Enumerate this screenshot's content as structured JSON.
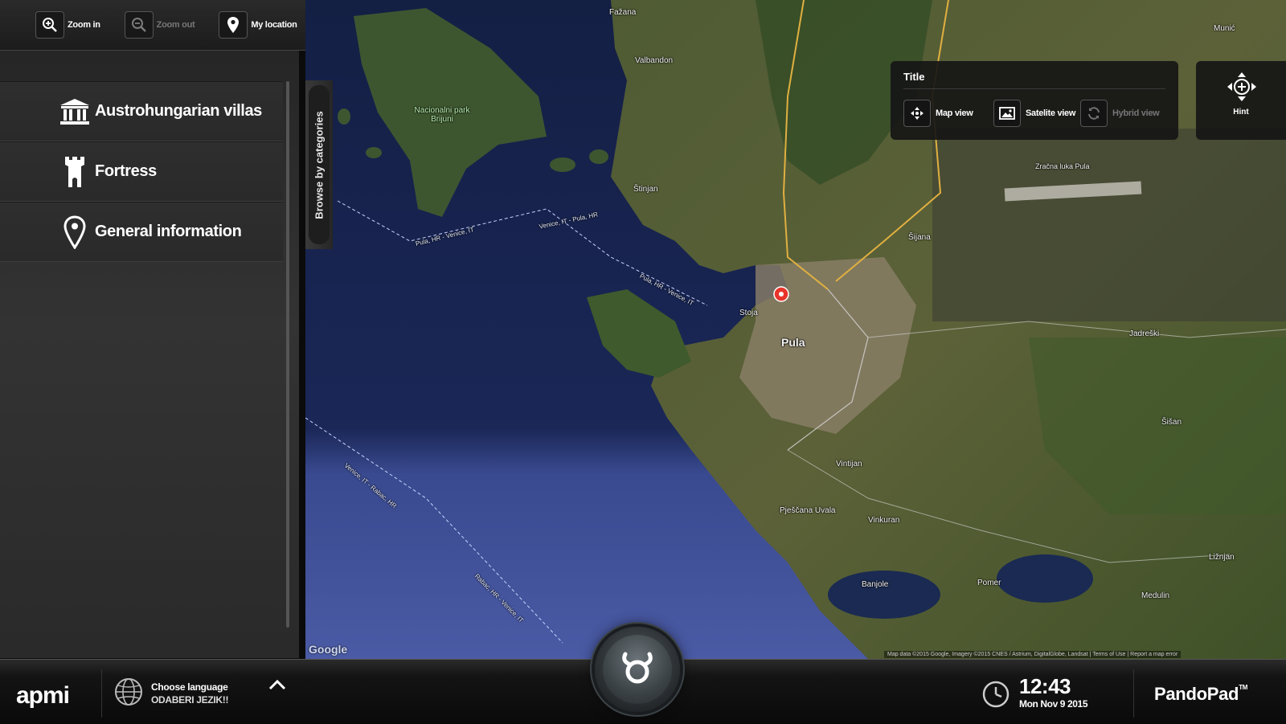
{
  "toolbar": {
    "zoom_in": "Zoom in",
    "zoom_out": "Zoom out",
    "my_location": "My location"
  },
  "sidebar": {
    "browse_label": "Browse by categories",
    "items": [
      {
        "label": "Austrohungarian villas",
        "icon": "museum-icon"
      },
      {
        "label": "Fortress",
        "icon": "tower-icon"
      },
      {
        "label": "General information",
        "icon": "location-pin-icon"
      }
    ]
  },
  "map_type": {
    "title": "Title",
    "map_view": "Map view",
    "satellite_view": "Satelite view",
    "hybrid_view": "Hybrid view"
  },
  "hint": {
    "label": "Hint"
  },
  "map": {
    "labels": {
      "pula": "Pula",
      "stinjan": "Štinjan",
      "fazana": "Fažana",
      "valbandon": "Valbandon",
      "veliki_brijun": "Nacionalni park Brijuni",
      "sijana": "Šijana",
      "vintijan": "Vintijan",
      "pjescana_uvala": "Pješčana Uvala",
      "vinkuran": "Vinkuran",
      "banjole": "Banjole",
      "premantura": "Pomer",
      "medulin": "Medulin",
      "liznjan": "Ližnjan",
      "sisan": "Šišan",
      "jadreski": "Jadreški",
      "airport": "Zračna luka Pula",
      "munic": "Munić",
      "stoja": "Stoja",
      "route1": "Pula, HR - Venice, IT",
      "route2": "Venice, IT - Pula, HR",
      "route3": "Pula, HR - Venice, IT",
      "route4": "Venice, IT - Rabac, HR",
      "route5": "Rabac, HR - Venice, IT"
    },
    "google": "Google",
    "attribution": "Map data ©2015 Google, Imagery ©2015 CNES / Astrium, DigitalGlobe, Landsat | Terms of Use | Report a map error"
  },
  "bottom": {
    "logo": "apmi",
    "lang_line1": "Choose language",
    "lang_line2": "ODABERI JEZIK!!",
    "time": "12:43",
    "date": "Mon Nov 9 2015",
    "brand": "PandoPad",
    "brand_tm": "TM"
  },
  "colors": {
    "sea_deep": "#16224a",
    "sea_light": "#3c4a8e",
    "land": "#4d5a33",
    "marker": "#e8352b"
  }
}
